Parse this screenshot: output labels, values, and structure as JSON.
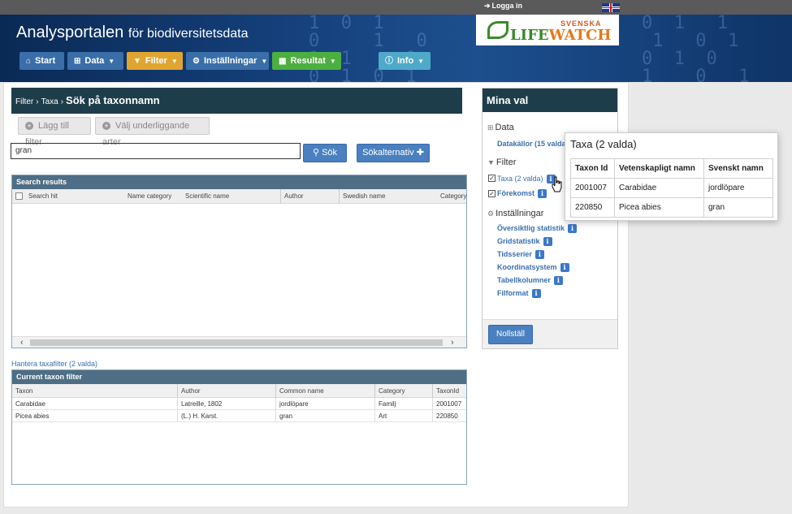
{
  "topbar": {
    "login_label": "Logga in",
    "language_flag": "uk-flag-icon"
  },
  "header": {
    "title_main": "Analysportalen",
    "title_sub": "för biodiversitetsdata",
    "logo_svenska": "SVENSKA",
    "logo_life": "LIFE",
    "logo_watch": "WATCH",
    "nav": [
      {
        "label": "Start",
        "icon": "home-icon",
        "color": "#3a6ea8"
      },
      {
        "label": "Data",
        "icon": "sitemap-icon",
        "color": "#3a6ea8"
      },
      {
        "label": "Filter",
        "icon": "filter-icon",
        "color": "#e0a530"
      },
      {
        "label": "Inställningar",
        "icon": "cogs-icon",
        "color": "#3a6ea8"
      },
      {
        "label": "Resultat",
        "icon": "chart-icon",
        "color": "#4caf3f"
      },
      {
        "label": "Info",
        "icon": "info-icon",
        "color": "#4eaac8"
      }
    ]
  },
  "breadcrumb": {
    "items": [
      "Filter",
      "Taxa"
    ],
    "current": "Sök på taxonnamn"
  },
  "actions": {
    "add_filter": "Lägg till filter",
    "select_species": "Välj underliggande arter"
  },
  "search": {
    "value": "gran",
    "search_button": "Sök",
    "options_button": "Sökalternativ"
  },
  "search_results": {
    "title": "Search results",
    "columns": [
      "Search hit",
      "Name category",
      "Scientific name",
      "Author",
      "Swedish name",
      "Category"
    ]
  },
  "manage_link": "Hantera taxafilter (2 valda)",
  "current_filter": {
    "title": "Current taxon filter",
    "columns": [
      "Taxon",
      "Author",
      "Common name",
      "Category",
      "TaxonId"
    ],
    "rows": [
      [
        "Carabidae",
        "Latreille, 1802",
        "jordlöpare",
        "Familj",
        "2001007"
      ],
      [
        "Picea abies",
        "(L.) H. Karst.",
        "gran",
        "Art",
        "220850"
      ]
    ]
  },
  "mina_val": {
    "title": "Mina val",
    "data_heading": "Data",
    "datakallor": "Datakällor (15 valda)",
    "filter_heading": "Filter",
    "taxa": "Taxa (2 valda)",
    "forekomst": "Förekomst",
    "installningar_heading": "Inställningar",
    "settings": [
      "Översiktlig statistik",
      "Gridstatistik",
      "Tidsserier",
      "Koordinatsystem",
      "Tabellkolumner",
      "Filformat"
    ],
    "reset": "Nollställ"
  },
  "popover": {
    "title": "Taxa (2 valda)",
    "columns": [
      "Taxon Id",
      "Vetenskapligt namn",
      "Svenskt namn"
    ],
    "rows": [
      [
        "2001007",
        "Carabidae",
        "jordlöpare"
      ],
      [
        "220850",
        "Picea abies",
        "gran"
      ]
    ]
  }
}
